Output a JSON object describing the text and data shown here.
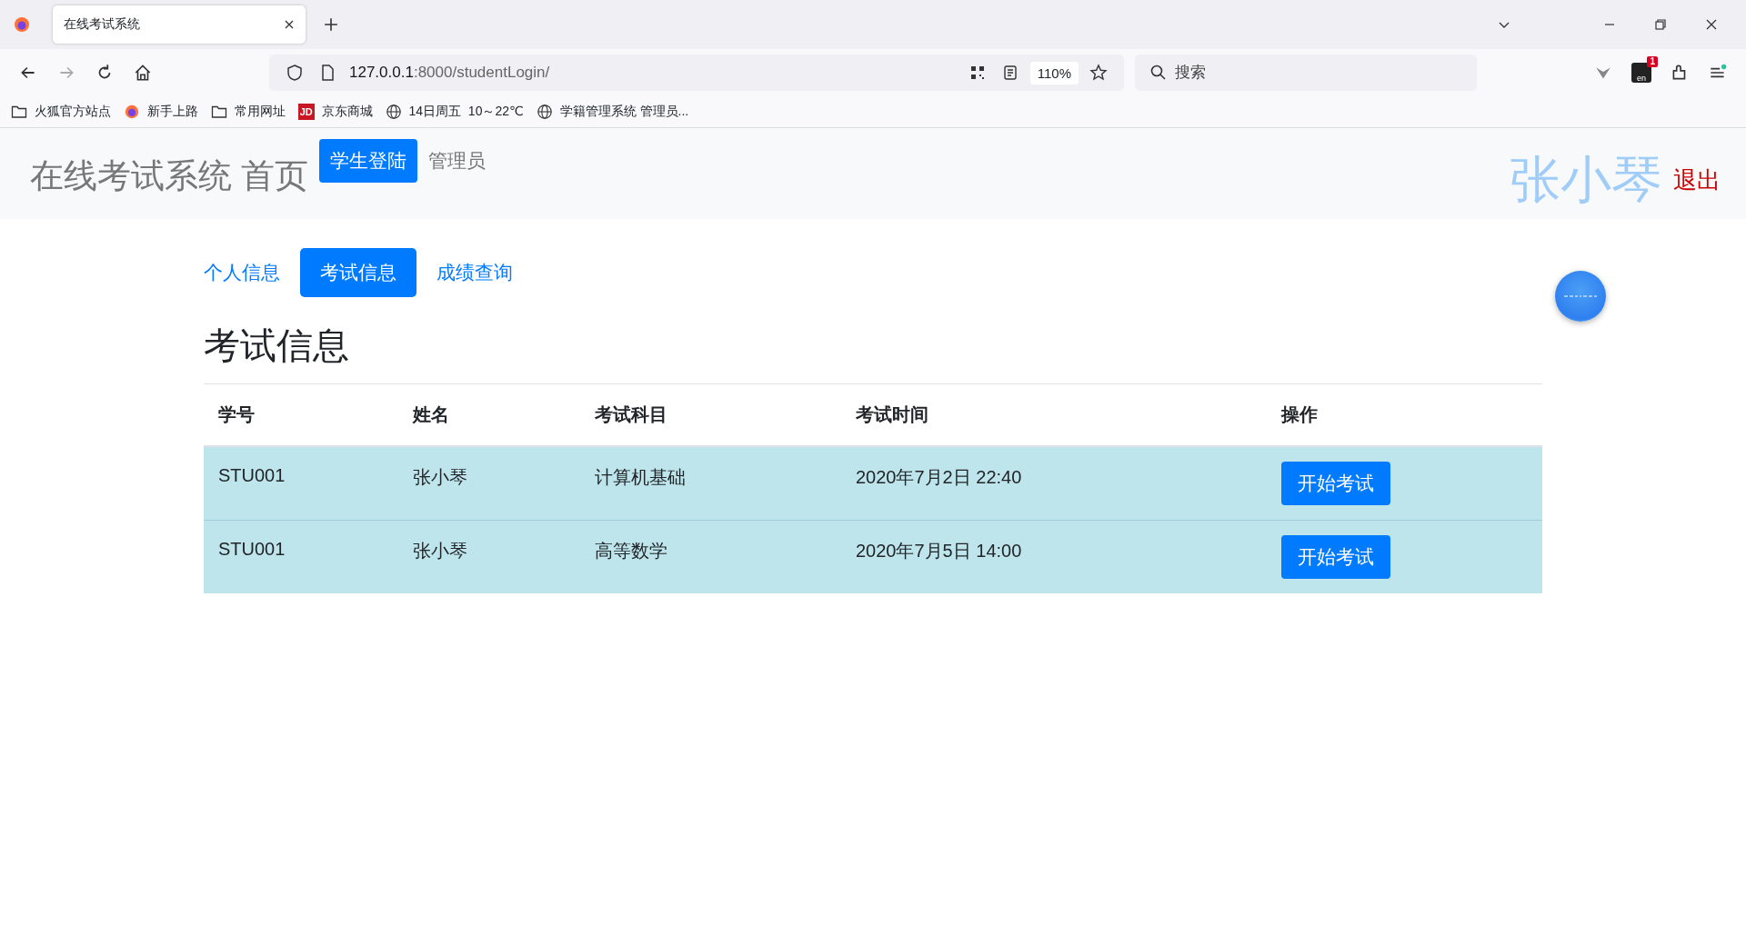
{
  "browser": {
    "tab_title": "在线考试系统",
    "url_host": "127.0.0.1",
    "url_rest": ":8000/studentLogin/",
    "zoom": "110%",
    "search_placeholder": "搜索",
    "extension_badge": "1",
    "extension_label": "en",
    "bookmarks": [
      {
        "kind": "folder",
        "label": "火狐官方站点"
      },
      {
        "kind": "firefox",
        "label": "新手上路"
      },
      {
        "kind": "folder",
        "label": "常用网址"
      },
      {
        "kind": "logo",
        "logo_text": "JD",
        "label": "京东商城"
      },
      {
        "kind": "globe",
        "label": "14日周五  10～22℃"
      },
      {
        "kind": "globe",
        "label": "学籍管理系统 管理员..."
      }
    ]
  },
  "header": {
    "brand": "在线考试系统 首页",
    "nav": [
      {
        "label": "学生登陆",
        "selected": true
      },
      {
        "label": "管理员",
        "selected": false
      }
    ],
    "user": "张小琴",
    "logout": "退出"
  },
  "tabs": [
    {
      "label": "个人信息",
      "selected": false
    },
    {
      "label": "考试信息",
      "selected": true
    },
    {
      "label": "成绩查询",
      "selected": false
    }
  ],
  "heading": "考试信息",
  "table": {
    "columns": [
      "学号",
      "姓名",
      "考试科目",
      "考试时间",
      "操作"
    ],
    "rows": [
      {
        "cells": [
          "STU001",
          "张小琴",
          "计算机基础",
          "2020年7月2日 22:40"
        ],
        "action": "开始考试"
      },
      {
        "cells": [
          "STU001",
          "张小琴",
          "高等数学",
          "2020年7月5日 14:00"
        ],
        "action": "开始考试"
      }
    ]
  }
}
